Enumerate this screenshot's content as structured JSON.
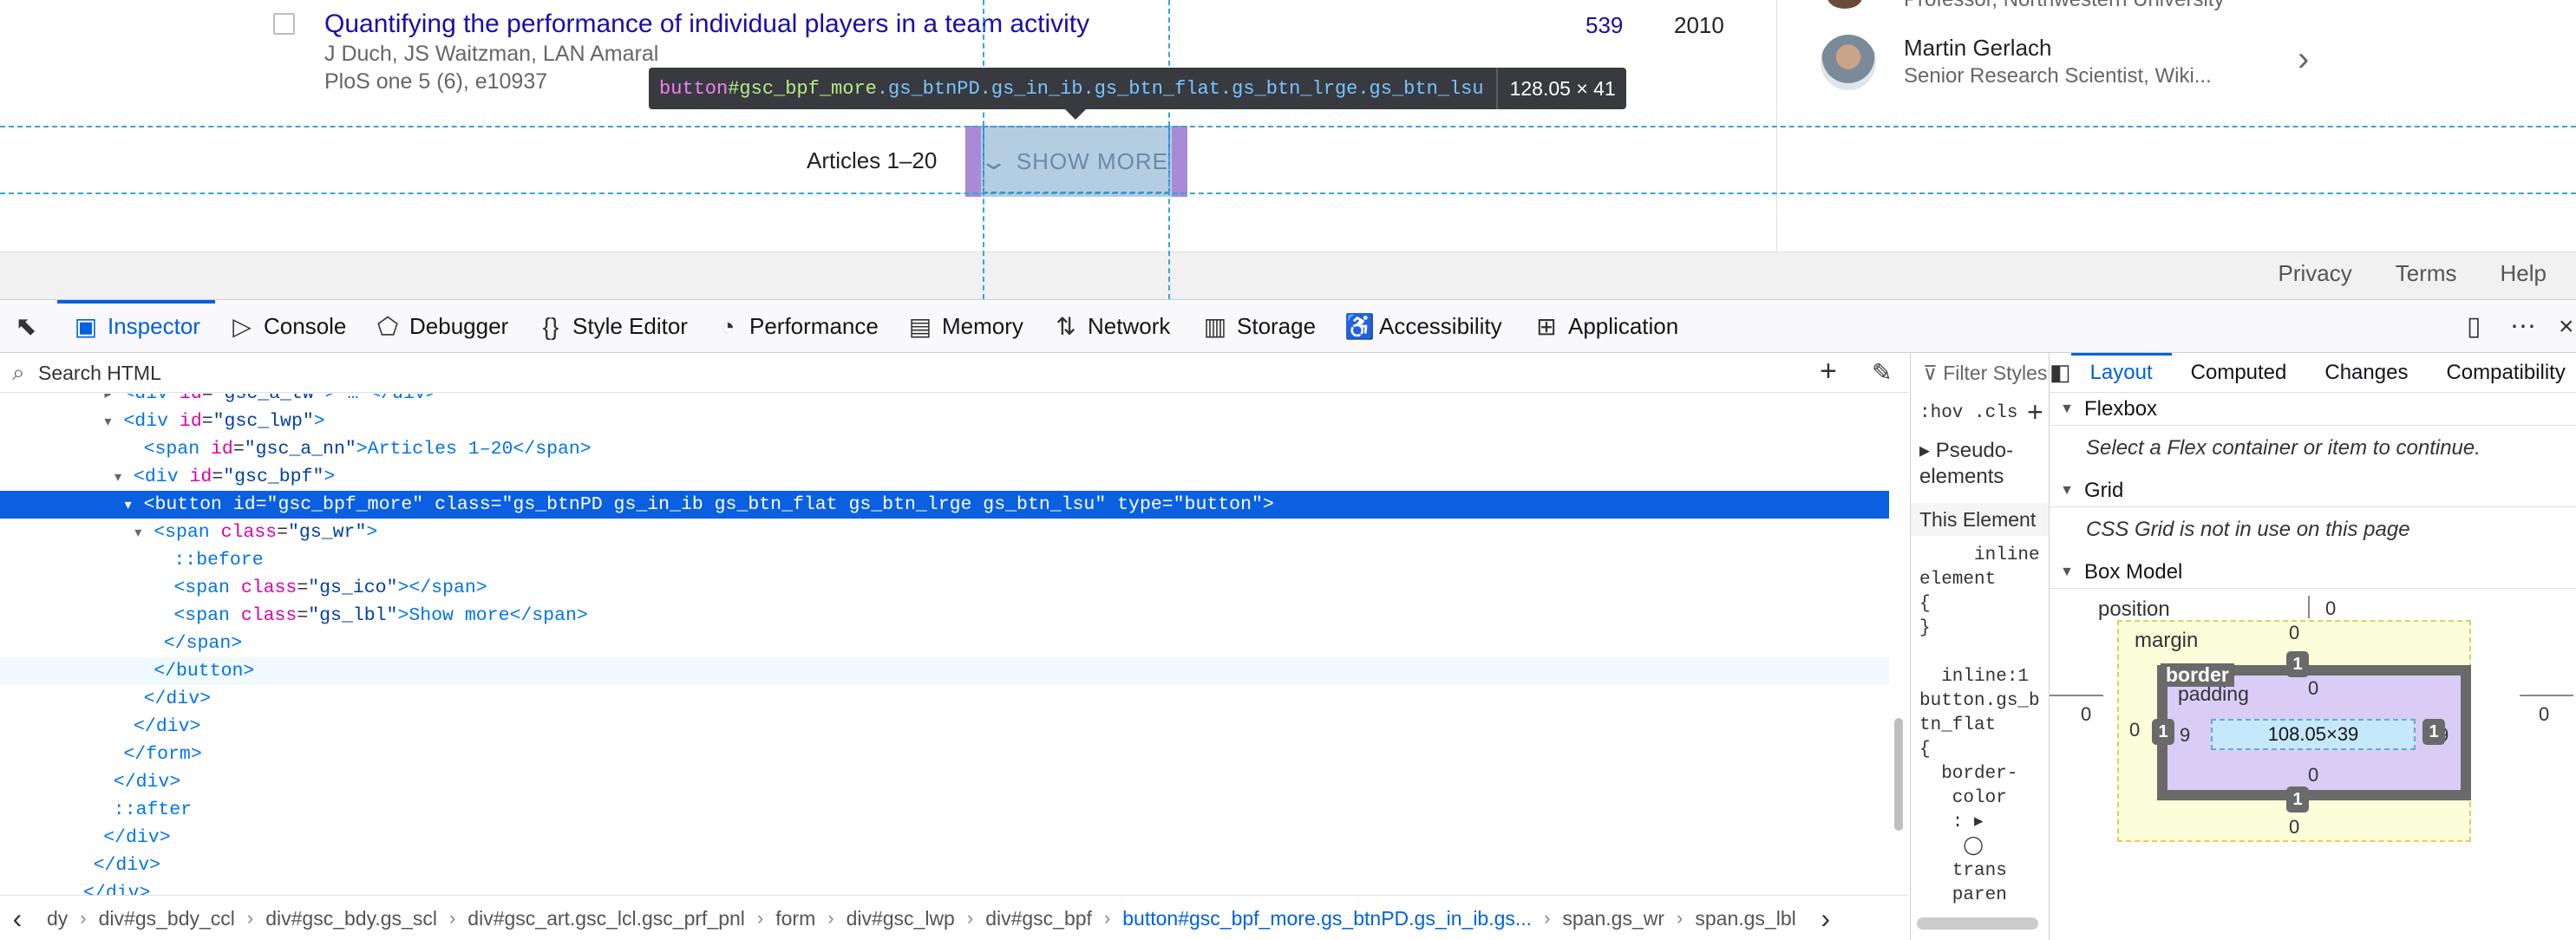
{
  "page": {
    "article": {
      "title": "Quantifying the performance of individual players in a team activity",
      "authors": "J Duch, JS Waitzman, LAN Amaral",
      "venue": "PloS one 5 (6), e10937",
      "cited_by": "539",
      "year": "2010"
    },
    "sidebar": {
      "top_text": "Professor, Northwestern University",
      "person_name": "Martin Gerlach",
      "person_title": "Senior Research Scientist, Wiki..."
    },
    "articles_count": "Articles 1–20",
    "show_more": "SHOW MORE",
    "footer_links": [
      "Privacy",
      "Terms",
      "Help"
    ]
  },
  "highlight_tooltip": {
    "tag": "button",
    "id": "#gsc_bpf_more",
    "classes": ".gs_btnPD.gs_in_ib.gs_btn_flat.gs_btn_lrge.gs_btn_lsu",
    "size": "128.05 × 41"
  },
  "devtools": {
    "tabs": [
      "Inspector",
      "Console",
      "Debugger",
      "Style Editor",
      "Performance",
      "Memory",
      "Network",
      "Storage",
      "Accessibility",
      "Application"
    ],
    "active_tab": "Inspector",
    "search_placeholder": "Search HTML",
    "markup": [
      {
        "indent": 9,
        "twisty": "▸",
        "pre": "<",
        "tag": "div",
        "attrs": [
          {
            "n": "id",
            "v": "\"gsc_a_tw\""
          }
        ],
        "post": "> … </div>",
        "text": ""
      },
      {
        "indent": 9,
        "twisty": "▾",
        "pre": "<",
        "tag": "div",
        "attrs": [
          {
            "n": "id",
            "v": "\"gsc_lwp\""
          }
        ],
        "post": ">",
        "text": ""
      },
      {
        "indent": 11,
        "twisty": "",
        "pre": "<",
        "tag": "span",
        "attrs": [
          {
            "n": "id",
            "v": "\"gsc_a_nn\""
          }
        ],
        "post": ">Articles 1–20</span>",
        "text": ""
      },
      {
        "indent": 10,
        "twisty": "▾",
        "pre": "<",
        "tag": "div",
        "attrs": [
          {
            "n": "id",
            "v": "\"gsc_bpf\""
          }
        ],
        "post": ">",
        "text": ""
      },
      {
        "indent": 11,
        "twisty": "▾",
        "pre": "<",
        "tag": "button",
        "attrs": [
          {
            "n": "id",
            "v": "\"gsc_bpf_more\""
          },
          {
            "n": "class",
            "v": "\"gs_btnPD gs_in_ib gs_btn_flat gs_btn_lrge gs_btn_lsu\""
          },
          {
            "n": "type",
            "v": "\"button\""
          }
        ],
        "post": ">",
        "text": ""
      },
      {
        "indent": 12,
        "twisty": "▾",
        "pre": "<",
        "tag": "span",
        "attrs": [
          {
            "n": "class",
            "v": "\"gs_wr\""
          }
        ],
        "post": ">",
        "text": ""
      },
      {
        "indent": 14,
        "twisty": "",
        "pre": "",
        "tag": "",
        "attrs": [],
        "post": "",
        "text": "::before"
      },
      {
        "indent": 14,
        "twisty": "",
        "pre": "<",
        "tag": "span",
        "attrs": [
          {
            "n": "class",
            "v": "\"gs_ico\""
          }
        ],
        "post": "></span>",
        "text": ""
      },
      {
        "indent": 14,
        "twisty": "",
        "pre": "<",
        "tag": "span",
        "attrs": [
          {
            "n": "class",
            "v": "\"gs_lbl\""
          }
        ],
        "post": ">Show more</span>",
        "text": ""
      },
      {
        "indent": 13,
        "twisty": "",
        "pre": "</",
        "tag": "span",
        "attrs": [],
        "post": ">",
        "text": ""
      },
      {
        "indent": 12,
        "twisty": "",
        "pre": "</",
        "tag": "button",
        "attrs": [],
        "post": ">",
        "text": ""
      },
      {
        "indent": 11,
        "twisty": "",
        "pre": "</",
        "tag": "div",
        "attrs": [],
        "post": ">",
        "text": ""
      },
      {
        "indent": 10,
        "twisty": "",
        "pre": "</",
        "tag": "div",
        "attrs": [],
        "post": ">",
        "text": ""
      },
      {
        "indent": 9,
        "twisty": "",
        "pre": "</",
        "tag": "form",
        "attrs": [],
        "post": ">",
        "text": ""
      },
      {
        "indent": 8,
        "twisty": "",
        "pre": "</",
        "tag": "div",
        "attrs": [],
        "post": ">",
        "text": ""
      },
      {
        "indent": 8,
        "twisty": "",
        "pre": "",
        "tag": "",
        "attrs": [],
        "post": "",
        "text": "::after"
      },
      {
        "indent": 7,
        "twisty": "",
        "pre": "</",
        "tag": "div",
        "attrs": [],
        "post": ">",
        "text": ""
      },
      {
        "indent": 6,
        "twisty": "",
        "pre": "</",
        "tag": "div",
        "attrs": [],
        "post": ">",
        "text": ""
      },
      {
        "indent": 5,
        "twisty": "",
        "pre": "</",
        "tag": "div",
        "attrs": [],
        "post": ">",
        "text": ""
      }
    ],
    "selected_line": 4,
    "hovered_line": 10,
    "breadcrumbs": [
      "dy",
      "div#gs_bdy_ccl",
      "div#gsc_bdy.gs_scl",
      "div#gsc_art.gsc_lcl.gsc_prf_pnl",
      "form",
      "div#gsc_lwp",
      "div#gsc_bpf",
      "button#gsc_bpf_more.gs_btnPD.gs_in_ib.gs...",
      "span.gs_wr",
      "span.gs_lbl"
    ],
    "current_breadcrumb": 7,
    "rules": {
      "filter_placeholder": "Filter Styles",
      "hov_cls": ":hov .cls",
      "pseudo_label": "Pseudo-\nelements",
      "this_element": "This Element",
      "code": "     inline\nelement \n{\n}\n\n  inline:1\nbutton.gs_b\ntn_flat \n{\n  border-\n   color\n   : ▸\n    ◯\n   trans\n   paren"
    },
    "layout_panel": {
      "tabs": [
        "Layout",
        "Computed",
        "Changes",
        "Compatibility"
      ],
      "active_tab": "Layout",
      "flexbox_title": "Flexbox",
      "flexbox_msg": "Select a Flex container or item to continue.",
      "grid_title": "Grid",
      "grid_msg": "CSS Grid is not in use on this page",
      "box_model_title": "Box Model",
      "box_model": {
        "position_label": "position",
        "position": {
          "top": "0",
          "right": "0",
          "bottom": "0",
          "left": "0"
        },
        "margin_label": "margin",
        "margin": {
          "top": "0",
          "right": "0",
          "bottom": "0",
          "left": "0"
        },
        "border_label": "border",
        "border": {
          "top": "1",
          "right": "1",
          "bottom": "1",
          "left": "1"
        },
        "padding_label": "padding",
        "padding": {
          "top": "0",
          "right": "9",
          "bottom": "0",
          "left": "9"
        },
        "content": "108.05×39"
      }
    }
  },
  "colors": {
    "accent": "#0061e0",
    "link": "#1a0dab",
    "selection": "#0a60e0",
    "tooltip_bg": "#383a40"
  }
}
